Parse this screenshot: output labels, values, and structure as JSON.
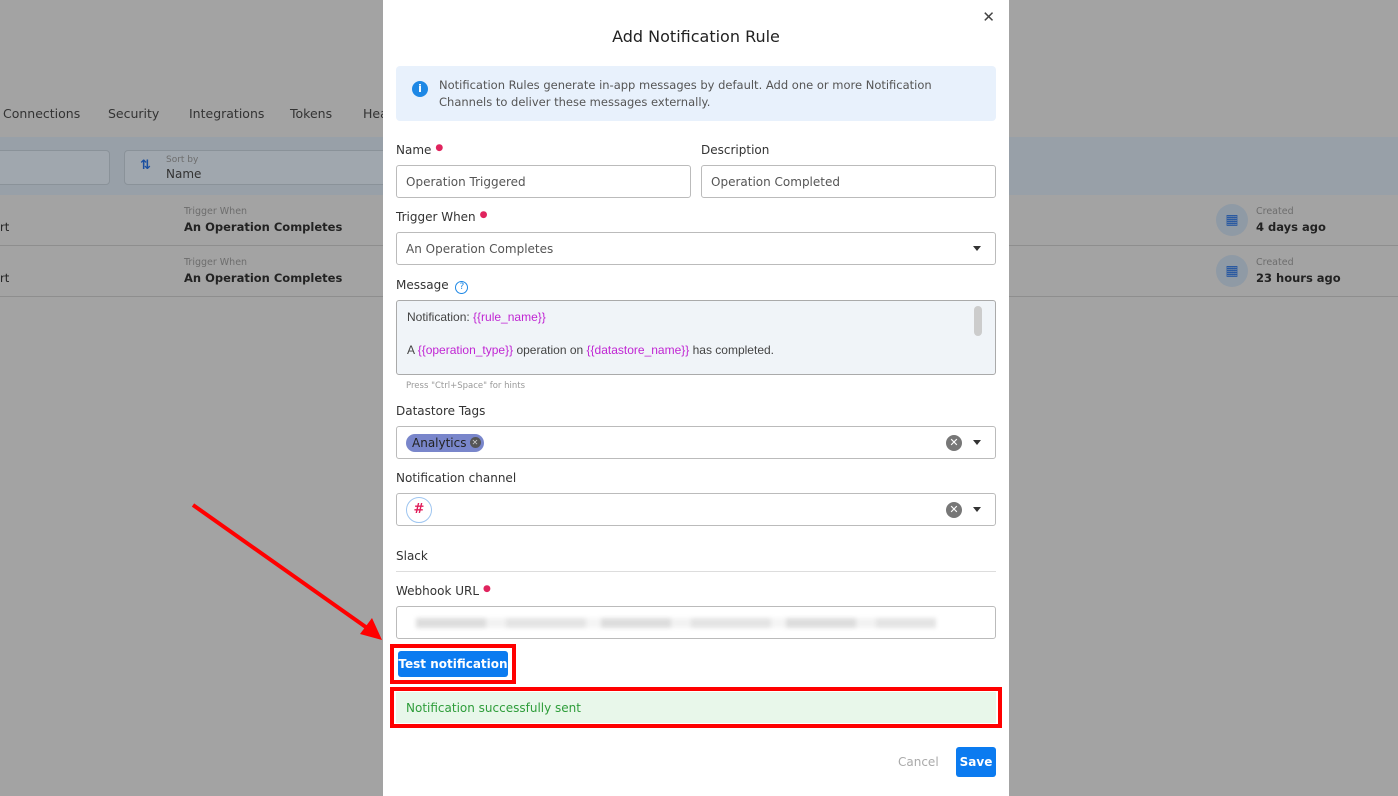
{
  "background": {
    "tabs": [
      "Connections",
      "Security",
      "Integrations",
      "Tokens",
      "Hea"
    ],
    "sort": {
      "label": "Sort by",
      "value": "Name"
    },
    "rows": [
      {
        "name_fragment": "rt",
        "trigger_label": "Trigger When",
        "trigger": "An Operation Completes",
        "created_label": "Created",
        "created": "4 days ago"
      },
      {
        "name_fragment": "rt",
        "trigger_label": "Trigger When",
        "trigger": "An Operation Completes",
        "created_label": "Created",
        "created": "23 hours ago"
      }
    ]
  },
  "modal": {
    "title": "Add Notification Rule",
    "info": "Notification Rules generate in-app messages by default. Add one or more Notification Channels to deliver these messages externally.",
    "name_label": "Name",
    "name_value": "Operation Triggered",
    "description_label": "Description",
    "description_value": "Operation Completed",
    "trigger_label": "Trigger When",
    "trigger_value": "An Operation Completes",
    "message_label": "Message",
    "message": {
      "l1_text": "Notification: ",
      "l1_var": "{{rule_name}}",
      "l2_a": "A ",
      "l2_var1": "{{operation_type}}",
      "l2_b": " operation on ",
      "l2_var2": "{{datastore_name}}",
      "l2_c": " has completed."
    },
    "hint": "Press \"Ctrl+Space\" for hints",
    "tags_label": "Datastore Tags",
    "tag": "Analytics",
    "channel_label": "Notification channel",
    "slack_heading": "Slack",
    "webhook_label": "Webhook URL",
    "test_button": "Test notification",
    "success": "Notification successfully sent",
    "cancel": "Cancel",
    "save": "Save"
  },
  "colors": {
    "primary": "#0b7bf0",
    "highlight": "#ff0000",
    "success_bg": "#e8f7ea",
    "success_text": "#2e9d3a"
  }
}
